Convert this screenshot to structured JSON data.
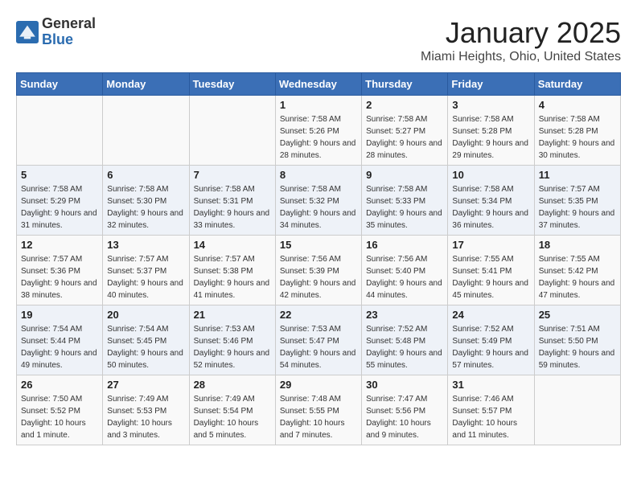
{
  "header": {
    "logo_general": "General",
    "logo_blue": "Blue",
    "title": "January 2025",
    "subtitle": "Miami Heights, Ohio, United States"
  },
  "weekdays": [
    "Sunday",
    "Monday",
    "Tuesday",
    "Wednesday",
    "Thursday",
    "Friday",
    "Saturday"
  ],
  "weeks": [
    [
      {
        "day": "",
        "sunrise": "",
        "sunset": "",
        "daylight": ""
      },
      {
        "day": "",
        "sunrise": "",
        "sunset": "",
        "daylight": ""
      },
      {
        "day": "",
        "sunrise": "",
        "sunset": "",
        "daylight": ""
      },
      {
        "day": "1",
        "sunrise": "Sunrise: 7:58 AM",
        "sunset": "Sunset: 5:26 PM",
        "daylight": "Daylight: 9 hours and 28 minutes."
      },
      {
        "day": "2",
        "sunrise": "Sunrise: 7:58 AM",
        "sunset": "Sunset: 5:27 PM",
        "daylight": "Daylight: 9 hours and 28 minutes."
      },
      {
        "day": "3",
        "sunrise": "Sunrise: 7:58 AM",
        "sunset": "Sunset: 5:28 PM",
        "daylight": "Daylight: 9 hours and 29 minutes."
      },
      {
        "day": "4",
        "sunrise": "Sunrise: 7:58 AM",
        "sunset": "Sunset: 5:28 PM",
        "daylight": "Daylight: 9 hours and 30 minutes."
      }
    ],
    [
      {
        "day": "5",
        "sunrise": "Sunrise: 7:58 AM",
        "sunset": "Sunset: 5:29 PM",
        "daylight": "Daylight: 9 hours and 31 minutes."
      },
      {
        "day": "6",
        "sunrise": "Sunrise: 7:58 AM",
        "sunset": "Sunset: 5:30 PM",
        "daylight": "Daylight: 9 hours and 32 minutes."
      },
      {
        "day": "7",
        "sunrise": "Sunrise: 7:58 AM",
        "sunset": "Sunset: 5:31 PM",
        "daylight": "Daylight: 9 hours and 33 minutes."
      },
      {
        "day": "8",
        "sunrise": "Sunrise: 7:58 AM",
        "sunset": "Sunset: 5:32 PM",
        "daylight": "Daylight: 9 hours and 34 minutes."
      },
      {
        "day": "9",
        "sunrise": "Sunrise: 7:58 AM",
        "sunset": "Sunset: 5:33 PM",
        "daylight": "Daylight: 9 hours and 35 minutes."
      },
      {
        "day": "10",
        "sunrise": "Sunrise: 7:58 AM",
        "sunset": "Sunset: 5:34 PM",
        "daylight": "Daylight: 9 hours and 36 minutes."
      },
      {
        "day": "11",
        "sunrise": "Sunrise: 7:57 AM",
        "sunset": "Sunset: 5:35 PM",
        "daylight": "Daylight: 9 hours and 37 minutes."
      }
    ],
    [
      {
        "day": "12",
        "sunrise": "Sunrise: 7:57 AM",
        "sunset": "Sunset: 5:36 PM",
        "daylight": "Daylight: 9 hours and 38 minutes."
      },
      {
        "day": "13",
        "sunrise": "Sunrise: 7:57 AM",
        "sunset": "Sunset: 5:37 PM",
        "daylight": "Daylight: 9 hours and 40 minutes."
      },
      {
        "day": "14",
        "sunrise": "Sunrise: 7:57 AM",
        "sunset": "Sunset: 5:38 PM",
        "daylight": "Daylight: 9 hours and 41 minutes."
      },
      {
        "day": "15",
        "sunrise": "Sunrise: 7:56 AM",
        "sunset": "Sunset: 5:39 PM",
        "daylight": "Daylight: 9 hours and 42 minutes."
      },
      {
        "day": "16",
        "sunrise": "Sunrise: 7:56 AM",
        "sunset": "Sunset: 5:40 PM",
        "daylight": "Daylight: 9 hours and 44 minutes."
      },
      {
        "day": "17",
        "sunrise": "Sunrise: 7:55 AM",
        "sunset": "Sunset: 5:41 PM",
        "daylight": "Daylight: 9 hours and 45 minutes."
      },
      {
        "day": "18",
        "sunrise": "Sunrise: 7:55 AM",
        "sunset": "Sunset: 5:42 PM",
        "daylight": "Daylight: 9 hours and 47 minutes."
      }
    ],
    [
      {
        "day": "19",
        "sunrise": "Sunrise: 7:54 AM",
        "sunset": "Sunset: 5:44 PM",
        "daylight": "Daylight: 9 hours and 49 minutes."
      },
      {
        "day": "20",
        "sunrise": "Sunrise: 7:54 AM",
        "sunset": "Sunset: 5:45 PM",
        "daylight": "Daylight: 9 hours and 50 minutes."
      },
      {
        "day": "21",
        "sunrise": "Sunrise: 7:53 AM",
        "sunset": "Sunset: 5:46 PM",
        "daylight": "Daylight: 9 hours and 52 minutes."
      },
      {
        "day": "22",
        "sunrise": "Sunrise: 7:53 AM",
        "sunset": "Sunset: 5:47 PM",
        "daylight": "Daylight: 9 hours and 54 minutes."
      },
      {
        "day": "23",
        "sunrise": "Sunrise: 7:52 AM",
        "sunset": "Sunset: 5:48 PM",
        "daylight": "Daylight: 9 hours and 55 minutes."
      },
      {
        "day": "24",
        "sunrise": "Sunrise: 7:52 AM",
        "sunset": "Sunset: 5:49 PM",
        "daylight": "Daylight: 9 hours and 57 minutes."
      },
      {
        "day": "25",
        "sunrise": "Sunrise: 7:51 AM",
        "sunset": "Sunset: 5:50 PM",
        "daylight": "Daylight: 9 hours and 59 minutes."
      }
    ],
    [
      {
        "day": "26",
        "sunrise": "Sunrise: 7:50 AM",
        "sunset": "Sunset: 5:52 PM",
        "daylight": "Daylight: 10 hours and 1 minute."
      },
      {
        "day": "27",
        "sunrise": "Sunrise: 7:49 AM",
        "sunset": "Sunset: 5:53 PM",
        "daylight": "Daylight: 10 hours and 3 minutes."
      },
      {
        "day": "28",
        "sunrise": "Sunrise: 7:49 AM",
        "sunset": "Sunset: 5:54 PM",
        "daylight": "Daylight: 10 hours and 5 minutes."
      },
      {
        "day": "29",
        "sunrise": "Sunrise: 7:48 AM",
        "sunset": "Sunset: 5:55 PM",
        "daylight": "Daylight: 10 hours and 7 minutes."
      },
      {
        "day": "30",
        "sunrise": "Sunrise: 7:47 AM",
        "sunset": "Sunset: 5:56 PM",
        "daylight": "Daylight: 10 hours and 9 minutes."
      },
      {
        "day": "31",
        "sunrise": "Sunrise: 7:46 AM",
        "sunset": "Sunset: 5:57 PM",
        "daylight": "Daylight: 10 hours and 11 minutes."
      },
      {
        "day": "",
        "sunrise": "",
        "sunset": "",
        "daylight": ""
      }
    ]
  ]
}
